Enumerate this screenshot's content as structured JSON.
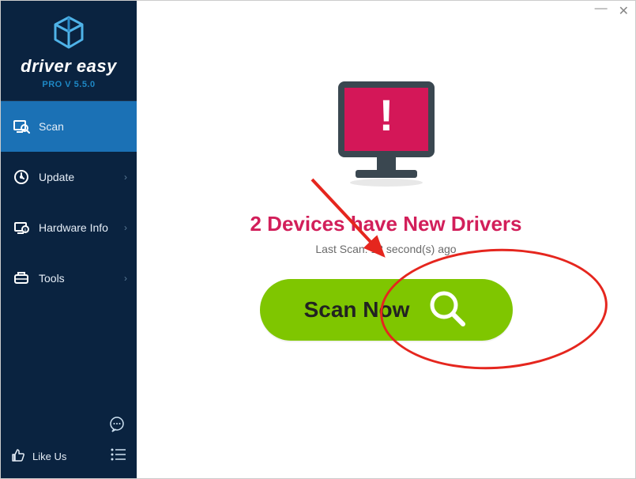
{
  "brand": {
    "name": "driver easy",
    "version_label": "PRO V 5.5.0"
  },
  "sidebar": {
    "items": [
      {
        "label": "Scan",
        "active": true
      },
      {
        "label": "Update",
        "active": false
      },
      {
        "label": "Hardware Info",
        "active": false
      },
      {
        "label": "Tools",
        "active": false
      }
    ],
    "like_label": "Like Us"
  },
  "main": {
    "headline": "2 Devices have New Drivers",
    "last_scan": "Last Scan: 13 second(s) ago",
    "scan_button_label": "Scan Now"
  },
  "colors": {
    "sidebar_bg": "#0a2340",
    "active_item": "#1b71b5",
    "headline": "#d21f5a",
    "button_green": "#7fc600",
    "annotation_red": "#e5261e",
    "monitor_screen": "#d41758"
  }
}
